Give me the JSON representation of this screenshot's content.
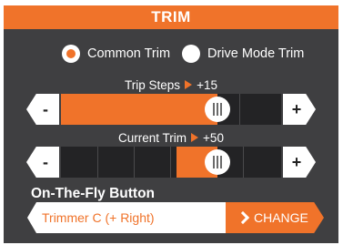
{
  "header": {
    "title": "TRIM"
  },
  "trim_mode": {
    "options": [
      {
        "label": "Common Trim",
        "selected": true
      },
      {
        "label": "Drive Mode Trim",
        "selected": false
      }
    ]
  },
  "trip_steps": {
    "label": "Trip Steps",
    "value_text": "+15",
    "value_fraction": 0.71,
    "minus_label": "-",
    "plus_label": "+"
  },
  "current_trim": {
    "label": "Current Trim",
    "value_text": "+50",
    "value_fraction": 0.71,
    "minus_label": "-",
    "plus_label": "+"
  },
  "on_the_fly": {
    "title": "On-The-Fly Button",
    "value": "Trimmer C (+ Right)",
    "change_label": "CHANGE"
  },
  "colors": {
    "accent": "#f0732a",
    "panel": "#3f3f41",
    "track": "#232325"
  },
  "icons": {
    "radio_selected": "radio-selected-icon",
    "radio_unselected": "radio-unselected-icon",
    "slider_knob": "knob-grip-icon",
    "change_chevron": "chevron-right-icon"
  }
}
